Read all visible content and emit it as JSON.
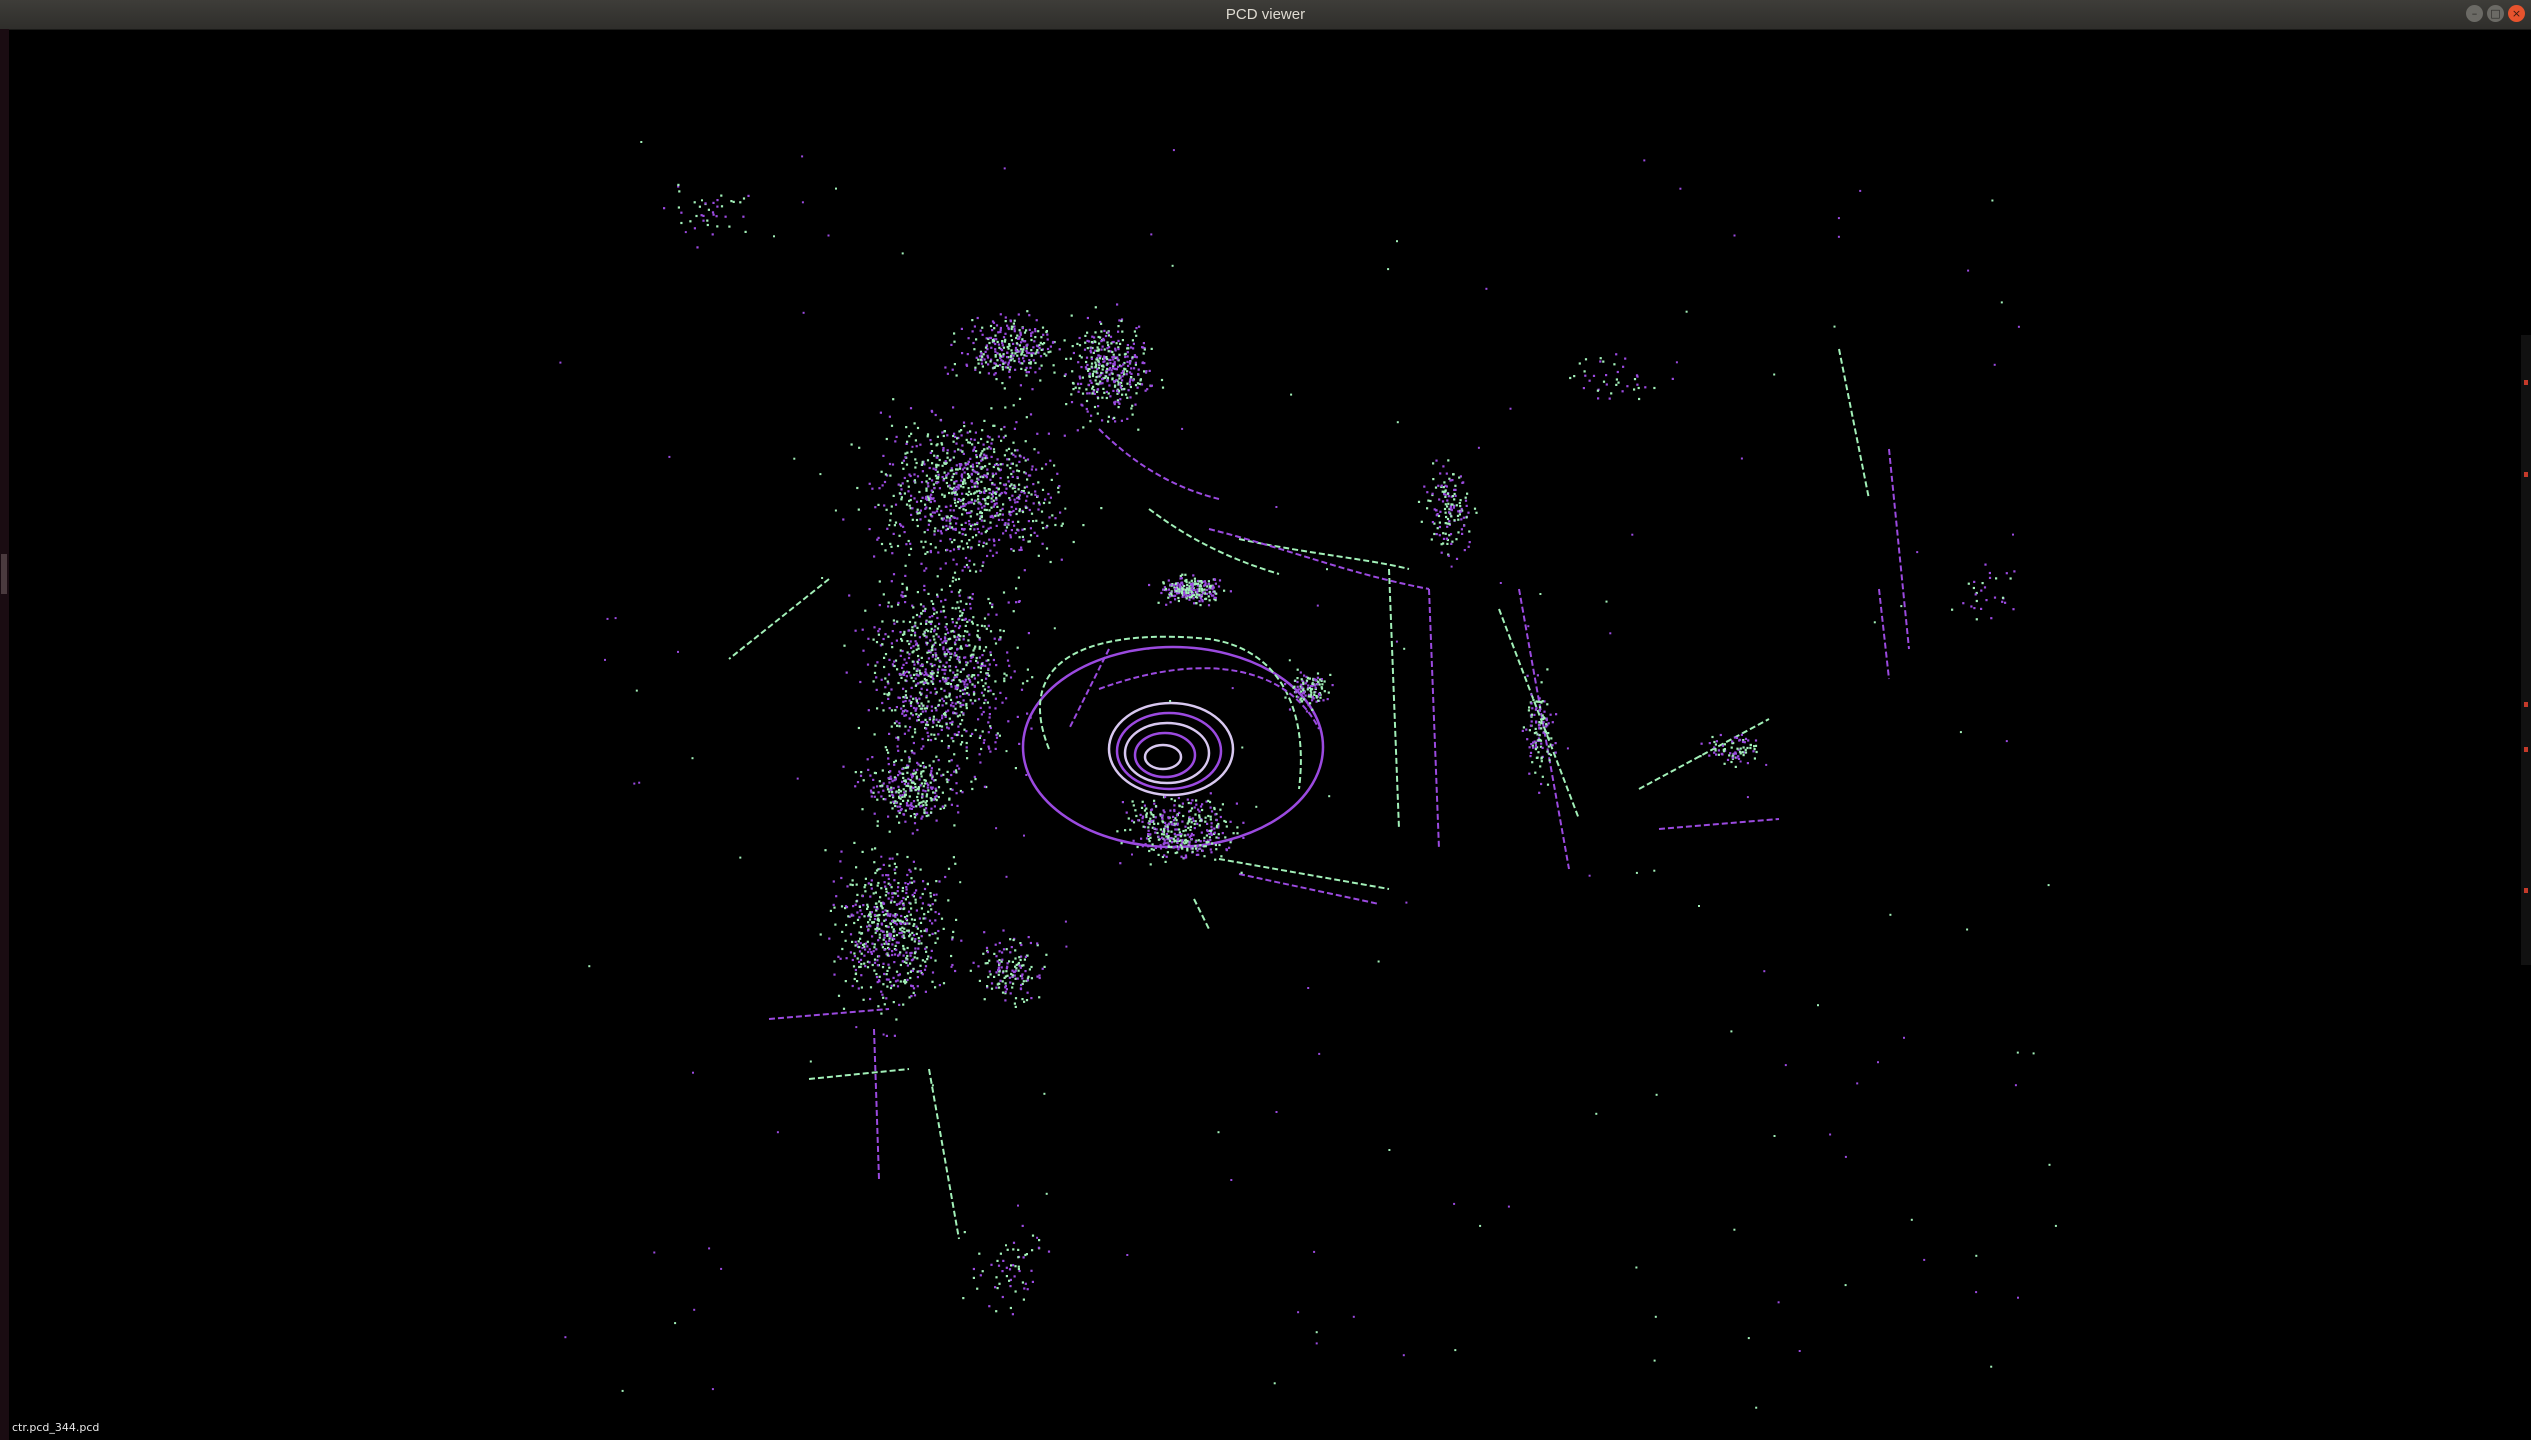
{
  "window": {
    "title": "PCD viewer"
  },
  "window_buttons": {
    "minimize": "–",
    "maximize": "□",
    "close": "×"
  },
  "status": {
    "file_label": "ctr.pcd_344.pcd"
  },
  "colors": {
    "series_a": "#a2f0b8",
    "series_b": "#9b4ae0",
    "background": "#000000"
  },
  "icons": [
    "minimize-icon",
    "maximize-icon",
    "close-icon"
  ]
}
